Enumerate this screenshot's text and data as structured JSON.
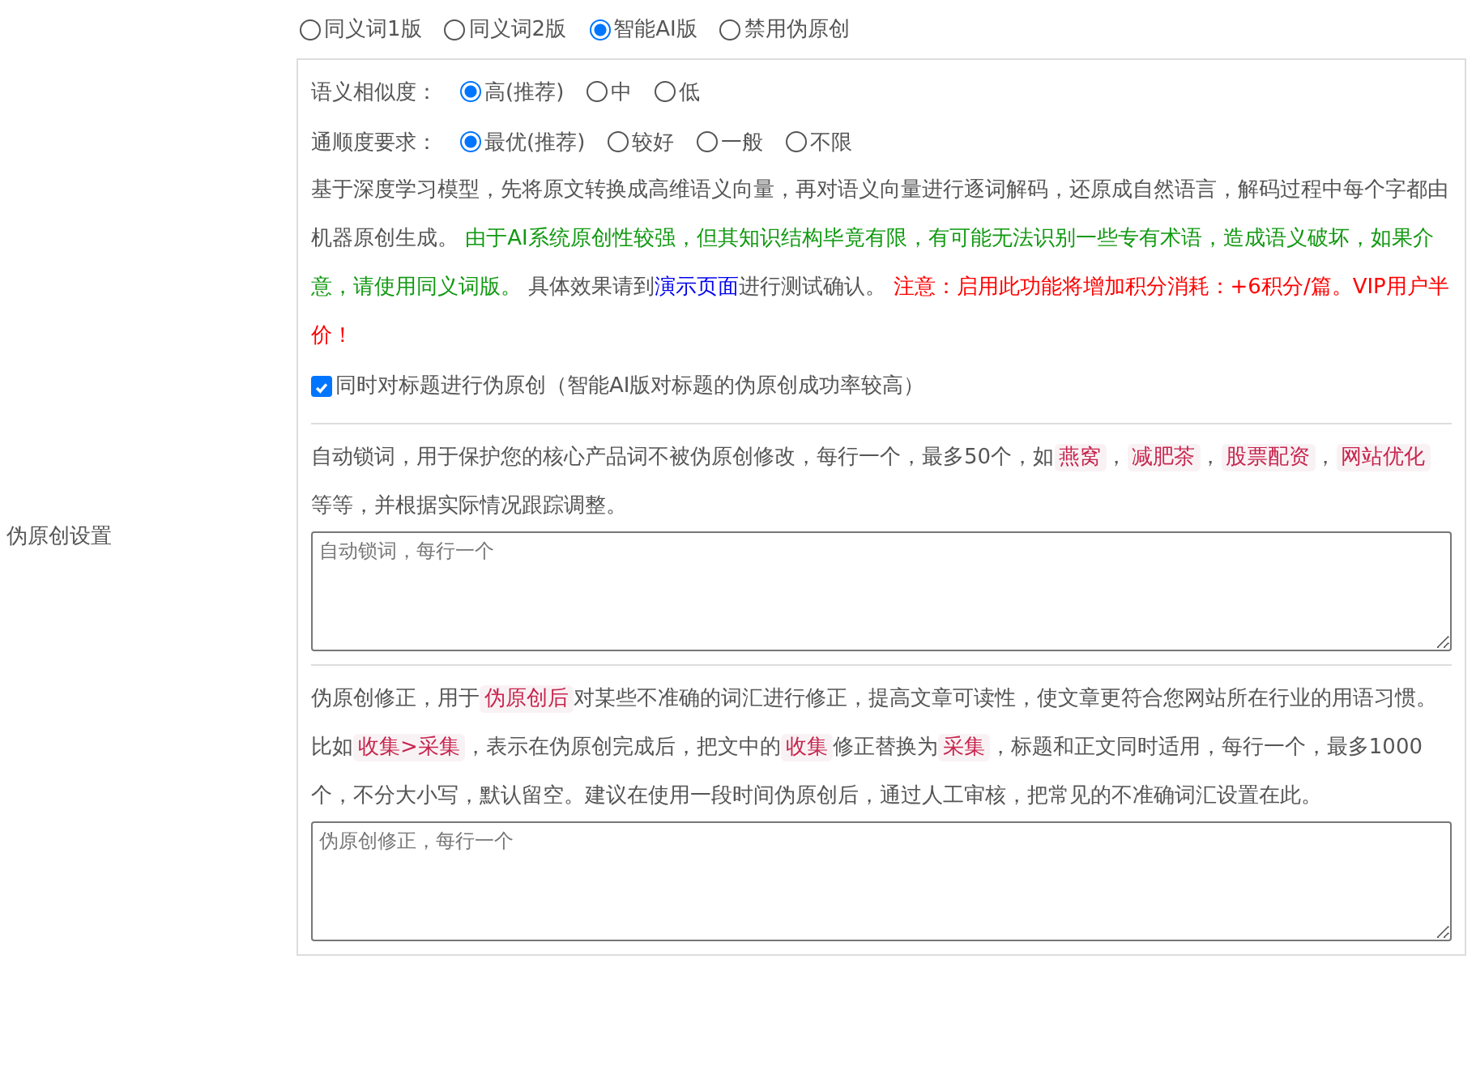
{
  "section_label": "伪原创设置",
  "modes": [
    {
      "label": "同义词1版",
      "selected": false
    },
    {
      "label": "同义词2版",
      "selected": false
    },
    {
      "label": "智能AI版",
      "selected": true
    },
    {
      "label": "禁用伪原创",
      "selected": false
    }
  ],
  "similarity": {
    "label": "语义相似度：",
    "options": [
      {
        "label": "高(推荐)",
        "selected": true
      },
      {
        "label": "中",
        "selected": false
      },
      {
        "label": "低",
        "selected": false
      }
    ]
  },
  "fluency": {
    "label": "通顺度要求：",
    "options": [
      {
        "label": "最优(推荐)",
        "selected": true
      },
      {
        "label": "较好",
        "selected": false
      },
      {
        "label": "一般",
        "selected": false
      },
      {
        "label": "不限",
        "selected": false
      }
    ]
  },
  "ai_description": [
    {
      "kind": "plain",
      "text": "基于深度学习模型，先将原文转换成高维语义向量，再对语义向量进行逐词解码，还原成自然语言，解码过程中每个字都由机器原创生成。 "
    },
    {
      "kind": "green",
      "text": "由于AI系统原创性较强，但其知识结构毕竟有限，有可能无法识别一些专有术语，造成语义破坏，如果介意，请使用同义词版。"
    },
    {
      "kind": "plain",
      "text": " 具体效果请到"
    },
    {
      "kind": "link",
      "text": "演示页面"
    },
    {
      "kind": "plain",
      "text": "进行测试确认。 "
    },
    {
      "kind": "red",
      "text": "注意：启用此功能将增加积分消耗：+6积分/篇。VIP用户半价！"
    }
  ],
  "title_option": {
    "label": "同时对标题进行伪原创（智能AI版对标题的伪原创成功率较高）",
    "checked": true
  },
  "lock_words": {
    "description": [
      {
        "kind": "plain",
        "text": "自动锁词，用于保护您的核心产品词不被伪原创修改，每行一个，最多50个，如"
      },
      {
        "kind": "tag",
        "text": "燕窝"
      },
      {
        "kind": "plain",
        "text": "，"
      },
      {
        "kind": "tag",
        "text": "减肥茶"
      },
      {
        "kind": "plain",
        "text": "，"
      },
      {
        "kind": "tag",
        "text": "股票配资"
      },
      {
        "kind": "plain",
        "text": "，"
      },
      {
        "kind": "tag",
        "text": "网站优化"
      },
      {
        "kind": "plain",
        "text": " 等等，并根据实际情况跟踪调整。"
      }
    ],
    "placeholder": "自动锁词，每行一个"
  },
  "corrections": {
    "description": [
      {
        "kind": "plain",
        "text": "伪原创修正，用于"
      },
      {
        "kind": "tag",
        "text": "伪原创后"
      },
      {
        "kind": "plain",
        "text": "对某些不准确的词汇进行修正，提高文章可读性，使文章更符合您网站所在行业的用语习惯。比如"
      },
      {
        "kind": "tag",
        "text": "收集>采集"
      },
      {
        "kind": "plain",
        "text": "，表示在伪原创完成后，把文中的"
      },
      {
        "kind": "tag",
        "text": "收集"
      },
      {
        "kind": "plain",
        "text": "修正替换为"
      },
      {
        "kind": "tag",
        "text": "采集"
      },
      {
        "kind": "plain",
        "text": "，标题和正文同时适用，每行一个，最多1000个，不分大小写，默认留空。建议在使用一段时间伪原创后，通过人工审核，把常见的不准确词汇设置在此。"
      }
    ],
    "placeholder": "伪原创修正，每行一个"
  }
}
